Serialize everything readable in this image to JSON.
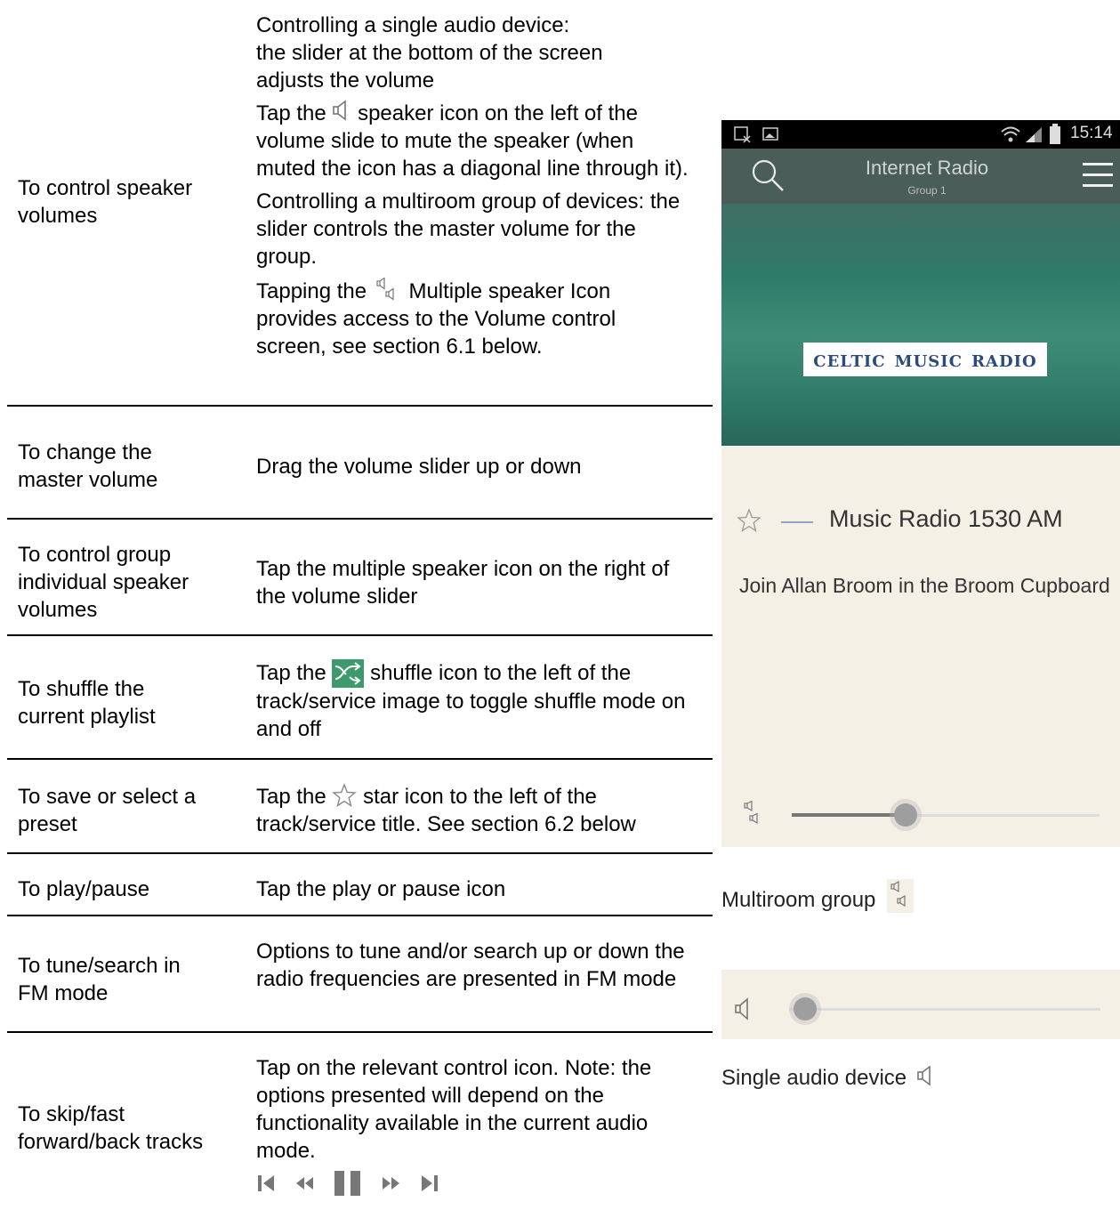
{
  "rows": [
    {
      "action": "To control speaker volumes",
      "desc_p1": "Controlling a single audio device:\nthe slider at the bottom of the screen adjusts the volume",
      "desc_p2_pre": "Tap the",
      "desc_p2_post": "speaker icon on the left of the volume slide to mute the speaker (when muted the icon has  a diagonal line through it).",
      "desc_p3": "Controlling a multiroom group of devices: the slider controls the master volume for the group.",
      "desc_p4_pre": "Tapping the",
      "desc_p4_post": "Multiple speaker Icon provides access to the Volume control screen, see section 6.1 below."
    },
    {
      "action": "To change the master volume",
      "desc": "Drag the volume slider up or down"
    },
    {
      "action": "To control group individual speaker volumes",
      "desc": "Tap the multiple speaker icon on the right of the volume slider"
    },
    {
      "action": "To shuffle the current playlist",
      "desc_pre": "Tap the",
      "desc_post": "shuffle icon to the left of the track/service image to toggle shuffle mode on and off"
    },
    {
      "action": "To save or select a preset",
      "desc_pre": "Tap the",
      "desc_post": "star icon to the left of the track/service title. See section 6.2 below"
    },
    {
      "action": "To play/pause",
      "desc": "Tap the play or pause icon"
    },
    {
      "action": "To tune/search in FM mode",
      "desc": "Options to tune and/or search up or down the radio frequencies are presented in FM mode"
    },
    {
      "action": "To skip/fast forward/back tracks",
      "desc": "Tap on the relevant control icon. Note: the options presented will depend on the functionality available in the current audio mode."
    }
  ],
  "phone": {
    "time": "15:14",
    "app_title": "Internet Radio",
    "app_subtitle": "Group 1",
    "logo_text": "celtic music radio",
    "station_name": "Music Radio 1530 AM",
    "show_text": "Join Allan Broom in the Broom Cupboard",
    "multiroom_volume": 0.37,
    "single_volume": 0.0
  },
  "captions": {
    "multiroom": "Multiroom group",
    "single": "Single audio device"
  },
  "icons": [
    "speaker-icon",
    "multi-speaker-icon",
    "shuffle-icon",
    "star-icon",
    "skip-back-icon",
    "rewind-icon",
    "pause-icon",
    "fast-forward-icon",
    "skip-forward-icon",
    "search-icon",
    "menu-icon"
  ]
}
